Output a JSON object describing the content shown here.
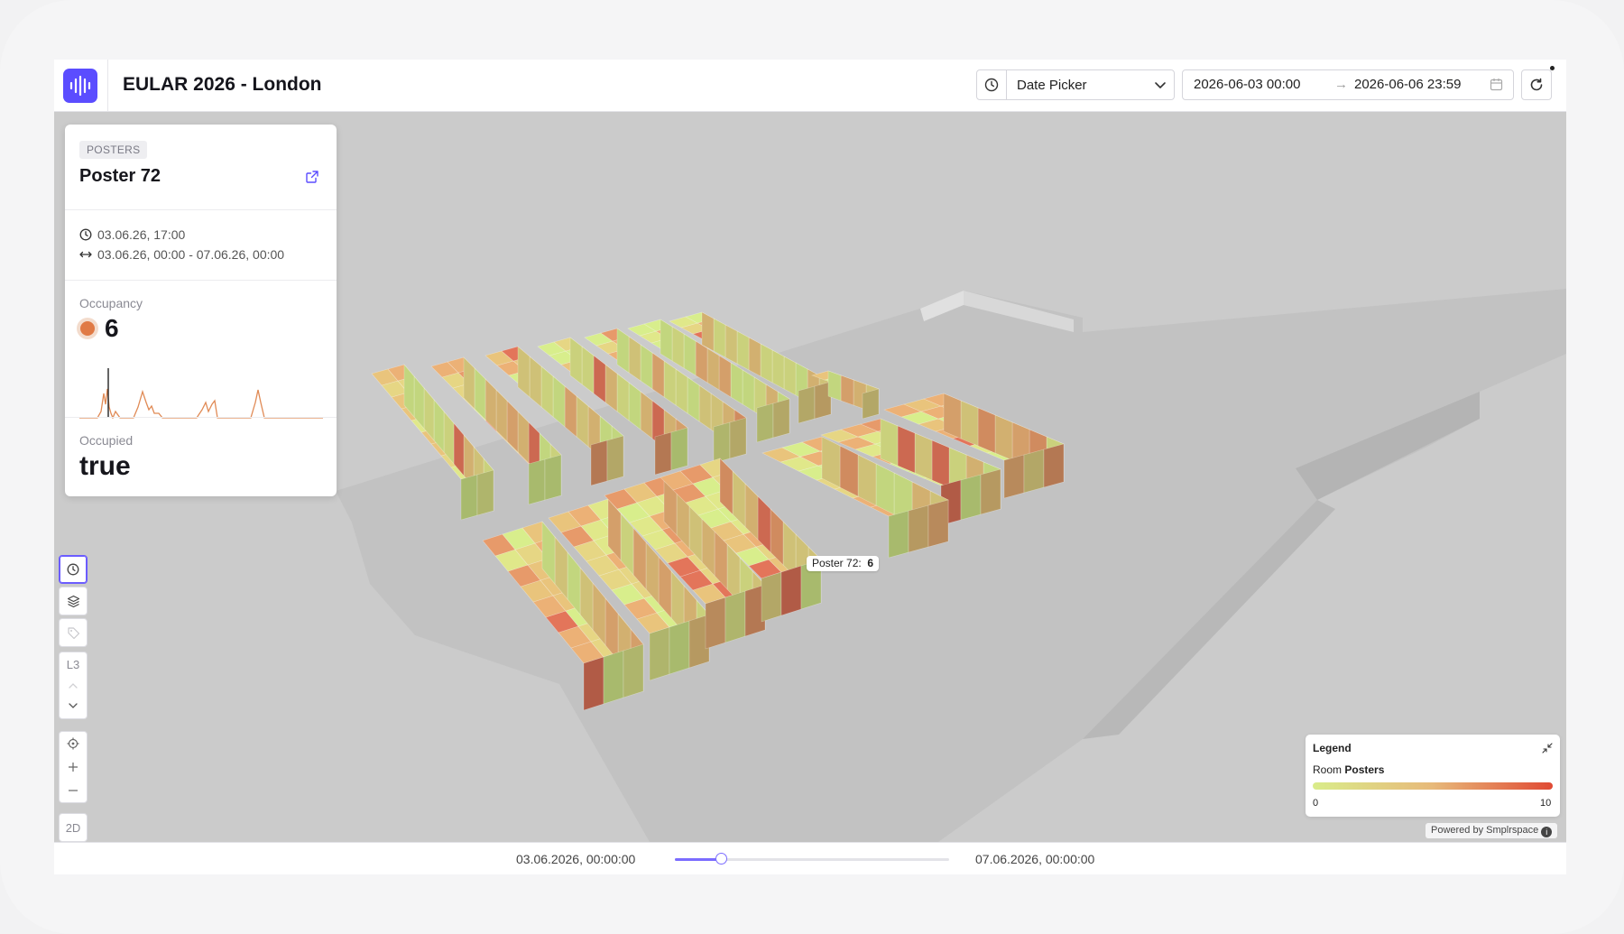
{
  "app": {
    "title": "EULAR 2026 - London",
    "logo_icon": "soundwave-logo-icon",
    "accent_color": "#5b4dff"
  },
  "toolbar": {
    "date_picker_label": "Date Picker",
    "range_start": "2026-06-03 00:00",
    "range_arrow": "→",
    "range_end": "2026-06-06 23:59"
  },
  "panel": {
    "category": "POSTERS",
    "name": "Poster 72",
    "timestamp": "03.06.26, 17:00",
    "period": "03.06.26, 00:00 - 07.06.26, 00:00",
    "occupancy_label": "Occupancy",
    "occupancy_value": "6",
    "occupancy_color": "#e07a45",
    "occupied_label": "Occupied",
    "occupied_value": "true"
  },
  "side_tools": {
    "level_label": "L3",
    "view_mode_label": "2D"
  },
  "tooltip": {
    "label": "Poster 72:",
    "value": "6"
  },
  "legend": {
    "title": "Legend",
    "room_prefix": "Room",
    "room_type": "Posters",
    "min": "0",
    "max": "10",
    "gradient_colors": [
      "#d9ec8a",
      "#e7b97a",
      "#e04a34"
    ]
  },
  "powered_by": "Powered by Smplrspace",
  "timeline": {
    "start": "03.06.2026, 00:00:00",
    "end": "07.06.2026, 00:00:00",
    "position": 0.17
  }
}
